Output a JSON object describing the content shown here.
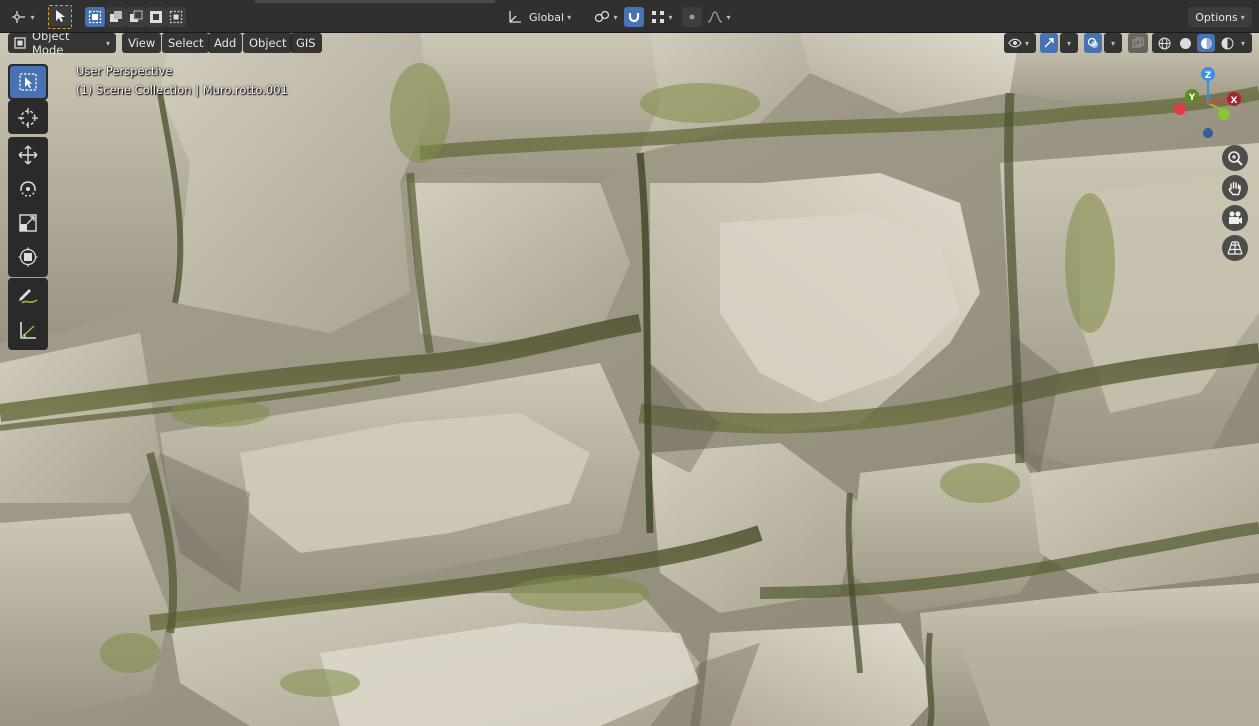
{
  "header": {
    "editor_type_icon": "view3d-editor-icon",
    "select_mode_icon": "cursor-icon",
    "box_select_icons": [
      "select-set-icon",
      "select-extend-icon",
      "select-subtract-icon",
      "select-intersect-icon"
    ],
    "orientation_label": "Global",
    "options_label": "Options"
  },
  "viewport_header": {
    "mode_label": "Object Mode",
    "menus": [
      "View",
      "Select",
      "Add",
      "Object",
      "GIS"
    ]
  },
  "overlay": {
    "view_name": "User Perspective",
    "collection_line": "(1) Scene Collection | Muro.rotto.001"
  },
  "gizmo": {
    "axes": [
      "Z",
      "Y",
      "X"
    ],
    "colors": {
      "x": "#e0394a",
      "y": "#8dc433",
      "z": "#3b8fe5",
      "neg_z": "#2f5d9e"
    }
  },
  "tools": [
    {
      "name": "select-box-tool",
      "active": true
    },
    {
      "name": "cursor-tool",
      "active": false
    },
    {
      "name": "move-tool",
      "active": false
    },
    {
      "name": "rotate-tool",
      "active": false
    },
    {
      "name": "scale-tool",
      "active": false
    },
    {
      "name": "transform-tool",
      "active": false
    },
    {
      "name": "annotate-tool",
      "active": false
    },
    {
      "name": "measure-tool",
      "active": false
    }
  ],
  "colors": {
    "accent": "#4772b3",
    "header_bg": "#303030",
    "stone_light": "#c9c2b1",
    "moss": "#6f7a3e"
  }
}
